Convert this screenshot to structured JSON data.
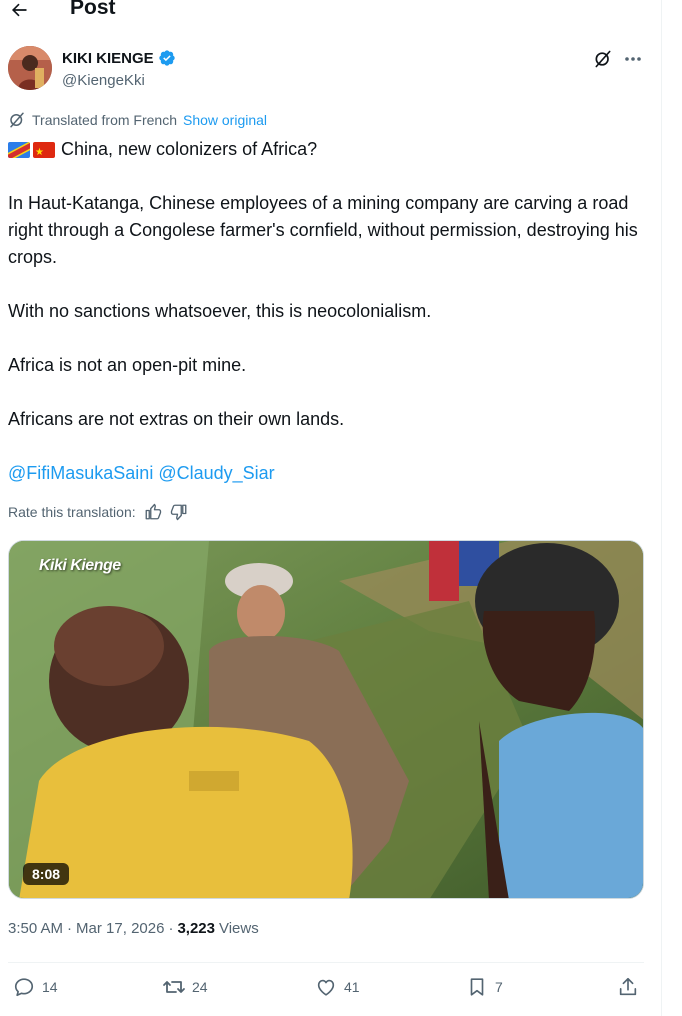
{
  "header": {
    "title": "Post"
  },
  "author": {
    "display_name": "KIKI KIENGE",
    "handle": "@KiengeKki",
    "verified_color": "#1d9bf0"
  },
  "translation": {
    "label": "Translated from French",
    "show_original": "Show original"
  },
  "tweet": {
    "line1": "China, new colonizers of Africa?",
    "para1": "In Haut-Katanga, Chinese employees of a mining company are carving a road right through a Congolese farmer's cornfield, without permission, destroying his crops.",
    "para2": "With no sanctions whatsoever, this is neocolonialism.",
    "para3": "Africa is not an open-pit mine.",
    "para4": "Africans are not extras on their own lands.",
    "mention1": "@FifiMasukaSaini",
    "mention2": "@Claudy_Siar"
  },
  "rate": {
    "label": "Rate this translation:"
  },
  "media": {
    "watermark": "Kiki Kienge",
    "duration": "8:08"
  },
  "meta": {
    "time": "3:50 AM",
    "sep1": "·",
    "date": "Mar 17, 2026",
    "sep2": "·",
    "views_count": "3,223",
    "views_label": "Views"
  },
  "actions": {
    "replies": "14",
    "reposts": "24",
    "likes": "41",
    "bookmarks": "7"
  },
  "colors": {
    "text_primary": "#0f1419",
    "text_secondary": "#536471",
    "link": "#1d9bf0"
  },
  "icons": [
    "back-arrow-icon",
    "verified-badge-icon",
    "grok-icon",
    "more-icon",
    "translate-icon",
    "thumbs-up-icon",
    "thumbs-down-icon",
    "reply-icon",
    "repost-icon",
    "like-icon",
    "bookmark-icon",
    "share-icon"
  ]
}
